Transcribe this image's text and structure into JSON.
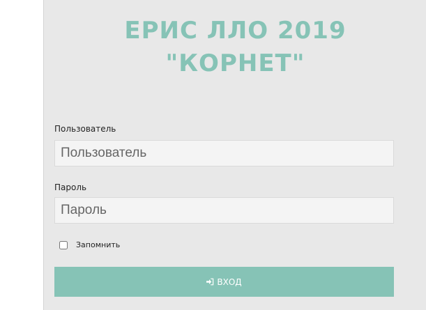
{
  "header": {
    "title_line1": "ЕРИС ЛЛО 2019",
    "title_line2": "\"КОРНЕТ\""
  },
  "form": {
    "username": {
      "label": "Пользователь",
      "placeholder": "Пользователь",
      "value": ""
    },
    "password": {
      "label": "Пароль",
      "placeholder": "Пароль",
      "value": ""
    },
    "remember": {
      "label": "Запомнить",
      "checked": false
    },
    "submit": {
      "label": "ВХОД",
      "icon": "sign-in-icon"
    }
  },
  "colors": {
    "accent": "#86c3b6",
    "panel_background": "#e8e8e8",
    "input_background": "#f4f4f4",
    "button_text": "#ffffff"
  }
}
